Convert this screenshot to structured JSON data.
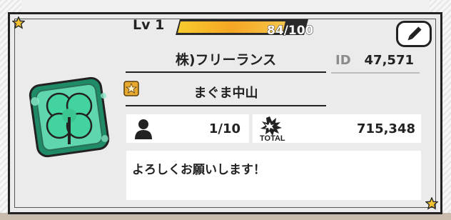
{
  "profile": {
    "level_label": "Lv 1",
    "xp_text": "84/100",
    "xp_progress": 0.84,
    "name": "株)フリーランス",
    "id_label": "ID",
    "id_value": "47,571",
    "guild_name": "まぐま中山",
    "friends_count": "1/10",
    "total_label": "TOTAL",
    "total_value": "715,348",
    "comment": "よろしくお願いします！"
  },
  "icons": {
    "edit": "pencil-icon",
    "rank": "rank-badge-icon",
    "friends": "person-icon",
    "total": "total-burst-icon",
    "corner": "star-icon",
    "avatar": "four-leaf-clover-avatar"
  },
  "colors": {
    "xp_fill": "#f5a623",
    "avatar_green": "#43d39e",
    "border_dark": "#222222"
  }
}
